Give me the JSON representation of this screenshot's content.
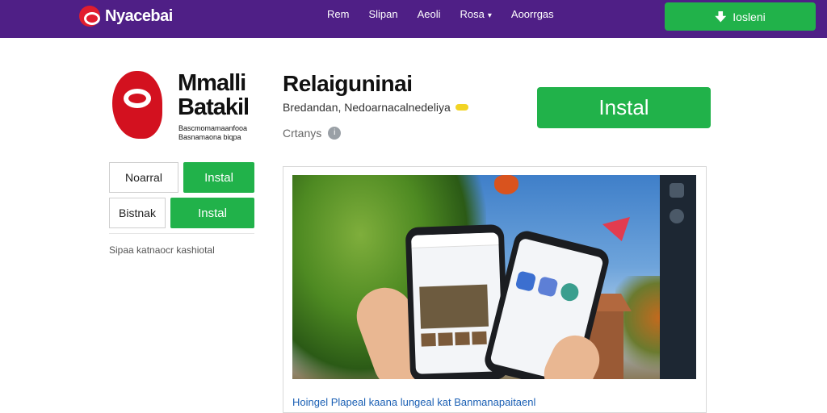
{
  "header": {
    "brand": "Nyacebai",
    "nav": [
      "Rem",
      "Slipan",
      "Aeoli",
      "Rosa",
      "Aoorrgas"
    ],
    "install_label": "Iosleni",
    "colors": {
      "bar": "#4f1f86",
      "accent": "#21b24a"
    }
  },
  "app": {
    "brand_title": "Mmalli Batakil",
    "brand_subtitle": "Bascmomamaanfooa Basnamaona biqpa",
    "title": "Relaiguninai",
    "developer": "Bredandan, Nedoarnacalnedeliya",
    "rating_label": "Crtanys",
    "install_label": "Instal"
  },
  "sidebar": {
    "rows": [
      {
        "label": "Noarral",
        "button": "Instal"
      },
      {
        "label": "Bistnak",
        "button": "Instal"
      }
    ],
    "note": "Sipaa katnaocr kashiotal"
  },
  "screenshot": {
    "caption": "Hoingel Plapeal kaana lungeal  kat Banmanapaitaenl"
  },
  "icons": [
    "logo-icon",
    "download-icon",
    "verified-badge-icon",
    "info-icon",
    "chevron-down-icon"
  ]
}
